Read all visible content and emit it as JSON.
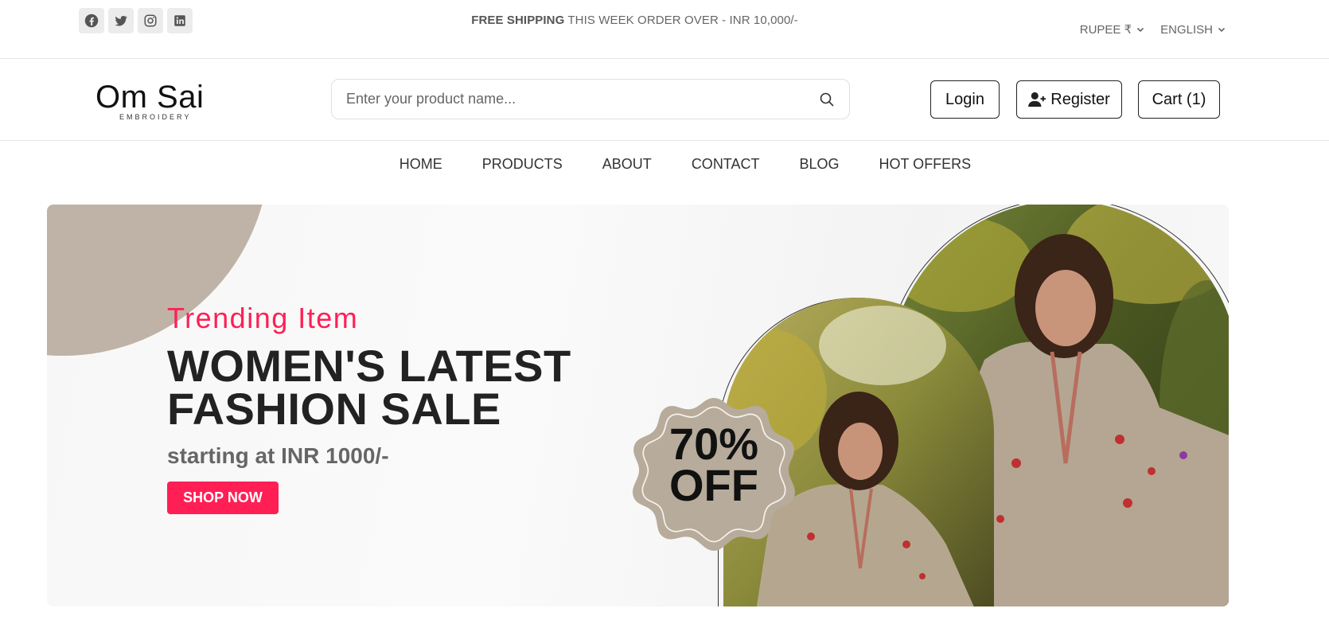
{
  "topbar": {
    "social": [
      "facebook-icon",
      "twitter-icon",
      "instagram-icon",
      "linkedin-icon"
    ],
    "promo_bold": "FREE SHIPPING",
    "promo_rest": " THIS WEEK ORDER OVER - INR 10,000/-",
    "currency": "RUPEE ₹",
    "language": "ENGLISH"
  },
  "header": {
    "logo_name": "Om Sai",
    "logo_tagline": "EMBROIDERY",
    "search_placeholder": "Enter your product name...",
    "login_label": "Login",
    "register_label": "Register",
    "cart_label": "Cart (1)"
  },
  "nav": {
    "items": [
      "HOME",
      "PRODUCTS",
      "ABOUT",
      "CONTACT",
      "BLOG",
      "HOT OFFERS"
    ]
  },
  "hero": {
    "subtitle": "Trending Item",
    "title_line1": "WOMEN'S LATEST",
    "title_line2": "FASHION SALE",
    "price": "starting at INR 1000/-",
    "cta": "SHOP NOW",
    "badge_line1": "70%",
    "badge_line2": "OFF"
  },
  "colors": {
    "accent": "#ff1f55",
    "badge": "#beb3a6",
    "text_dark": "#222222"
  }
}
